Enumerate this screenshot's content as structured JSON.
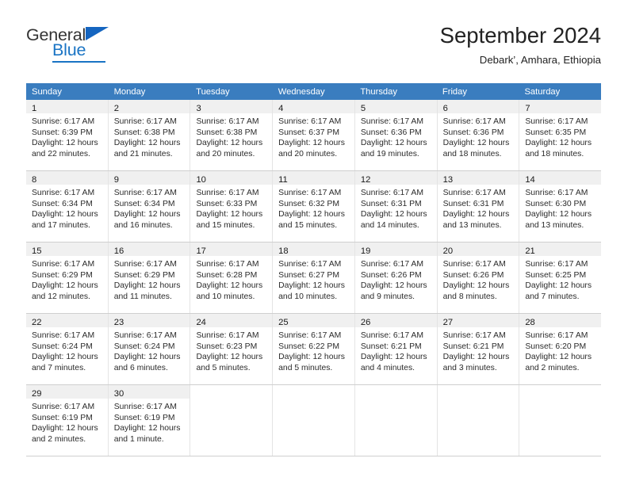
{
  "brand": {
    "name_part1": "General",
    "name_part2": "Blue"
  },
  "header": {
    "title": "September 2024",
    "subtitle": "Debark’, Amhara, Ethiopia"
  },
  "weekday_headers": [
    "Sunday",
    "Monday",
    "Tuesday",
    "Wednesday",
    "Thursday",
    "Friday",
    "Saturday"
  ],
  "colors": {
    "header_bar": "#3a7dbf",
    "daynum_strip": "#f0f0f0",
    "brand_blue": "#1a74c4",
    "text": "#2b2b2b"
  },
  "weeks": [
    [
      {
        "day": "1",
        "sunrise": "Sunrise: 6:17 AM",
        "sunset": "Sunset: 6:39 PM",
        "daylight1": "Daylight: 12 hours",
        "daylight2": "and 22 minutes."
      },
      {
        "day": "2",
        "sunrise": "Sunrise: 6:17 AM",
        "sunset": "Sunset: 6:38 PM",
        "daylight1": "Daylight: 12 hours",
        "daylight2": "and 21 minutes."
      },
      {
        "day": "3",
        "sunrise": "Sunrise: 6:17 AM",
        "sunset": "Sunset: 6:38 PM",
        "daylight1": "Daylight: 12 hours",
        "daylight2": "and 20 minutes."
      },
      {
        "day": "4",
        "sunrise": "Sunrise: 6:17 AM",
        "sunset": "Sunset: 6:37 PM",
        "daylight1": "Daylight: 12 hours",
        "daylight2": "and 20 minutes."
      },
      {
        "day": "5",
        "sunrise": "Sunrise: 6:17 AM",
        "sunset": "Sunset: 6:36 PM",
        "daylight1": "Daylight: 12 hours",
        "daylight2": "and 19 minutes."
      },
      {
        "day": "6",
        "sunrise": "Sunrise: 6:17 AM",
        "sunset": "Sunset: 6:36 PM",
        "daylight1": "Daylight: 12 hours",
        "daylight2": "and 18 minutes."
      },
      {
        "day": "7",
        "sunrise": "Sunrise: 6:17 AM",
        "sunset": "Sunset: 6:35 PM",
        "daylight1": "Daylight: 12 hours",
        "daylight2": "and 18 minutes."
      }
    ],
    [
      {
        "day": "8",
        "sunrise": "Sunrise: 6:17 AM",
        "sunset": "Sunset: 6:34 PM",
        "daylight1": "Daylight: 12 hours",
        "daylight2": "and 17 minutes."
      },
      {
        "day": "9",
        "sunrise": "Sunrise: 6:17 AM",
        "sunset": "Sunset: 6:34 PM",
        "daylight1": "Daylight: 12 hours",
        "daylight2": "and 16 minutes."
      },
      {
        "day": "10",
        "sunrise": "Sunrise: 6:17 AM",
        "sunset": "Sunset: 6:33 PM",
        "daylight1": "Daylight: 12 hours",
        "daylight2": "and 15 minutes."
      },
      {
        "day": "11",
        "sunrise": "Sunrise: 6:17 AM",
        "sunset": "Sunset: 6:32 PM",
        "daylight1": "Daylight: 12 hours",
        "daylight2": "and 15 minutes."
      },
      {
        "day": "12",
        "sunrise": "Sunrise: 6:17 AM",
        "sunset": "Sunset: 6:31 PM",
        "daylight1": "Daylight: 12 hours",
        "daylight2": "and 14 minutes."
      },
      {
        "day": "13",
        "sunrise": "Sunrise: 6:17 AM",
        "sunset": "Sunset: 6:31 PM",
        "daylight1": "Daylight: 12 hours",
        "daylight2": "and 13 minutes."
      },
      {
        "day": "14",
        "sunrise": "Sunrise: 6:17 AM",
        "sunset": "Sunset: 6:30 PM",
        "daylight1": "Daylight: 12 hours",
        "daylight2": "and 13 minutes."
      }
    ],
    [
      {
        "day": "15",
        "sunrise": "Sunrise: 6:17 AM",
        "sunset": "Sunset: 6:29 PM",
        "daylight1": "Daylight: 12 hours",
        "daylight2": "and 12 minutes."
      },
      {
        "day": "16",
        "sunrise": "Sunrise: 6:17 AM",
        "sunset": "Sunset: 6:29 PM",
        "daylight1": "Daylight: 12 hours",
        "daylight2": "and 11 minutes."
      },
      {
        "day": "17",
        "sunrise": "Sunrise: 6:17 AM",
        "sunset": "Sunset: 6:28 PM",
        "daylight1": "Daylight: 12 hours",
        "daylight2": "and 10 minutes."
      },
      {
        "day": "18",
        "sunrise": "Sunrise: 6:17 AM",
        "sunset": "Sunset: 6:27 PM",
        "daylight1": "Daylight: 12 hours",
        "daylight2": "and 10 minutes."
      },
      {
        "day": "19",
        "sunrise": "Sunrise: 6:17 AM",
        "sunset": "Sunset: 6:26 PM",
        "daylight1": "Daylight: 12 hours",
        "daylight2": "and 9 minutes."
      },
      {
        "day": "20",
        "sunrise": "Sunrise: 6:17 AM",
        "sunset": "Sunset: 6:26 PM",
        "daylight1": "Daylight: 12 hours",
        "daylight2": "and 8 minutes."
      },
      {
        "day": "21",
        "sunrise": "Sunrise: 6:17 AM",
        "sunset": "Sunset: 6:25 PM",
        "daylight1": "Daylight: 12 hours",
        "daylight2": "and 7 minutes."
      }
    ],
    [
      {
        "day": "22",
        "sunrise": "Sunrise: 6:17 AM",
        "sunset": "Sunset: 6:24 PM",
        "daylight1": "Daylight: 12 hours",
        "daylight2": "and 7 minutes."
      },
      {
        "day": "23",
        "sunrise": "Sunrise: 6:17 AM",
        "sunset": "Sunset: 6:24 PM",
        "daylight1": "Daylight: 12 hours",
        "daylight2": "and 6 minutes."
      },
      {
        "day": "24",
        "sunrise": "Sunrise: 6:17 AM",
        "sunset": "Sunset: 6:23 PM",
        "daylight1": "Daylight: 12 hours",
        "daylight2": "and 5 minutes."
      },
      {
        "day": "25",
        "sunrise": "Sunrise: 6:17 AM",
        "sunset": "Sunset: 6:22 PM",
        "daylight1": "Daylight: 12 hours",
        "daylight2": "and 5 minutes."
      },
      {
        "day": "26",
        "sunrise": "Sunrise: 6:17 AM",
        "sunset": "Sunset: 6:21 PM",
        "daylight1": "Daylight: 12 hours",
        "daylight2": "and 4 minutes."
      },
      {
        "day": "27",
        "sunrise": "Sunrise: 6:17 AM",
        "sunset": "Sunset: 6:21 PM",
        "daylight1": "Daylight: 12 hours",
        "daylight2": "and 3 minutes."
      },
      {
        "day": "28",
        "sunrise": "Sunrise: 6:17 AM",
        "sunset": "Sunset: 6:20 PM",
        "daylight1": "Daylight: 12 hours",
        "daylight2": "and 2 minutes."
      }
    ],
    [
      {
        "day": "29",
        "sunrise": "Sunrise: 6:17 AM",
        "sunset": "Sunset: 6:19 PM",
        "daylight1": "Daylight: 12 hours",
        "daylight2": "and 2 minutes."
      },
      {
        "day": "30",
        "sunrise": "Sunrise: 6:17 AM",
        "sunset": "Sunset: 6:19 PM",
        "daylight1": "Daylight: 12 hours",
        "daylight2": "and 1 minute."
      },
      {
        "day": "",
        "sunrise": "",
        "sunset": "",
        "daylight1": "",
        "daylight2": ""
      },
      {
        "day": "",
        "sunrise": "",
        "sunset": "",
        "daylight1": "",
        "daylight2": ""
      },
      {
        "day": "",
        "sunrise": "",
        "sunset": "",
        "daylight1": "",
        "daylight2": ""
      },
      {
        "day": "",
        "sunrise": "",
        "sunset": "",
        "daylight1": "",
        "daylight2": ""
      },
      {
        "day": "",
        "sunrise": "",
        "sunset": "",
        "daylight1": "",
        "daylight2": ""
      }
    ]
  ]
}
